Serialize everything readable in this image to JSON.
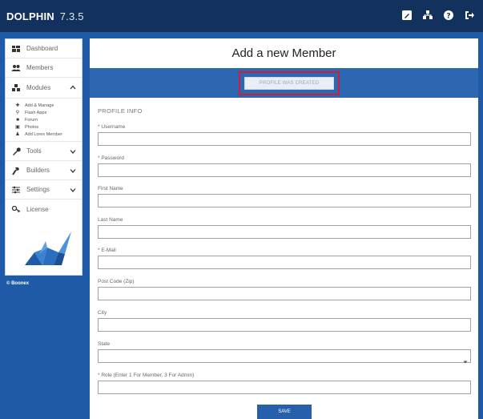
{
  "app": {
    "name": "DOLPHIN",
    "version": "7.3.5"
  },
  "topbar": {
    "icons": [
      "edit-icon",
      "sitemap-icon",
      "help-icon",
      "logout-icon"
    ]
  },
  "sidebar": {
    "items": [
      {
        "label": "Dashboard",
        "icon": "dashboard-icon"
      },
      {
        "label": "Members",
        "icon": "members-icon"
      },
      {
        "label": "Modules",
        "icon": "modules-icon"
      }
    ],
    "sub_items": [
      {
        "label": "Add & Manage",
        "icon": "plus-icon"
      },
      {
        "label": "Flash Apps",
        "icon": "pin-icon"
      },
      {
        "label": "Forum",
        "icon": "forum-icon"
      },
      {
        "label": "Photos",
        "icon": "photos-icon"
      },
      {
        "label": "Add Lorex Member",
        "icon": "user-add-icon"
      }
    ],
    "bottom_items": [
      {
        "label": "Tools",
        "icon": "wrench-icon"
      },
      {
        "label": "Builders",
        "icon": "hammer-icon"
      },
      {
        "label": "Settings",
        "icon": "sliders-icon"
      },
      {
        "label": "License",
        "icon": "key-icon"
      }
    ],
    "powered": "© Boonex"
  },
  "page": {
    "title": "Add a new Member",
    "banner_button": "PROFILE WAS CREATED"
  },
  "form": {
    "section": "PROFILE INFO",
    "fields": [
      {
        "label": "* Username",
        "value": ""
      },
      {
        "label": "* Password",
        "value": ""
      },
      {
        "label": "First Name",
        "value": ""
      },
      {
        "label": "Last Name",
        "value": ""
      },
      {
        "label": "* E-Mail",
        "value": ""
      },
      {
        "label": "Post Code (Zip)",
        "value": ""
      },
      {
        "label": "City",
        "value": ""
      }
    ],
    "state": {
      "label": "State",
      "value": ""
    },
    "role": {
      "label": "* Role (Enter 1 For Member, 3 For Admin)",
      "value": ""
    },
    "save_label": "SAVE"
  },
  "colors": {
    "topbar": "#12315c",
    "background": "#1f5aa6",
    "banner": "#2d67b1",
    "highlight": "#c8203a",
    "button": "#2660ad"
  }
}
